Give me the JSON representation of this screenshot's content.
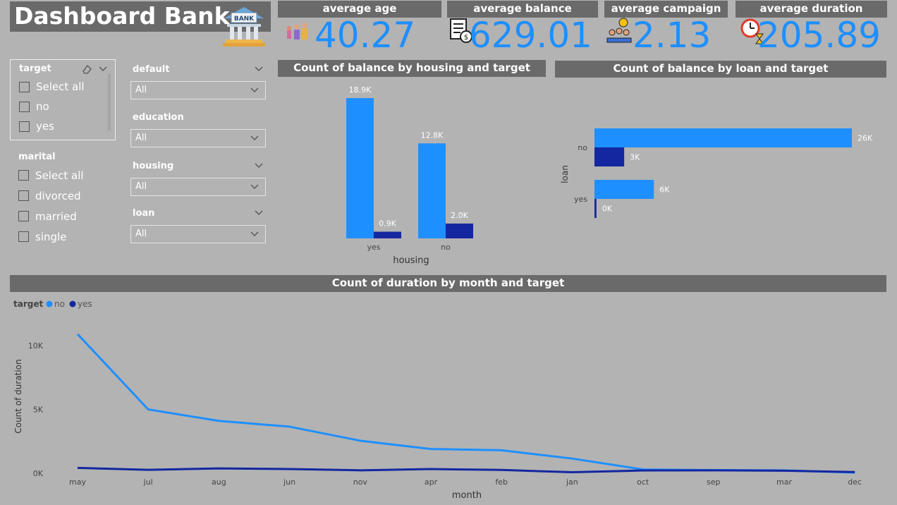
{
  "header": {
    "title": "Dashboard Bank",
    "bank_sign": "BANK"
  },
  "kpis": [
    {
      "label": "average age",
      "value": "40.27",
      "icon": "people-icon"
    },
    {
      "label": "average balance",
      "value": "629.01",
      "icon": "document-money-icon"
    },
    {
      "label": "average campaign",
      "value": "2.13",
      "icon": "meeting-icon"
    },
    {
      "label": "average duration",
      "value": "205.89",
      "icon": "clock-hourglass-icon"
    }
  ],
  "slicers": {
    "target": {
      "title": "target",
      "options": [
        "Select all",
        "no",
        "yes"
      ]
    },
    "marital": {
      "title": "marital",
      "options": [
        "Select all",
        "divorced",
        "married",
        "single"
      ]
    },
    "dropdowns": [
      {
        "label": "default",
        "value": "All"
      },
      {
        "label": "education",
        "value": "All"
      },
      {
        "label": "housing",
        "value": "All"
      },
      {
        "label": "loan",
        "value": "All"
      }
    ]
  },
  "colors": {
    "no": "#1e8fff",
    "yes": "#1427a0",
    "header_bg": "#6a6a6a",
    "page_bg": "#b3b3b3"
  },
  "chart_data": [
    {
      "type": "bar",
      "title": "Count of balance by housing and target",
      "xlabel": "housing",
      "categories": [
        "yes",
        "no"
      ],
      "series": [
        {
          "name": "no",
          "values": [
            18900,
            12800
          ],
          "labels": [
            "18.9K",
            "12.8K"
          ]
        },
        {
          "name": "yes",
          "values": [
            900,
            2000
          ],
          "labels": [
            "0.9K",
            "2.0K"
          ]
        }
      ]
    },
    {
      "type": "bar",
      "orientation": "horizontal",
      "title": "Count of balance by loan and target",
      "ylabel": "loan",
      "categories": [
        "no",
        "yes"
      ],
      "series": [
        {
          "name": "no",
          "values": [
            26000,
            6000
          ],
          "labels": [
            "26K",
            "6K"
          ]
        },
        {
          "name": "yes",
          "values": [
            3000,
            200
          ],
          "labels": [
            "3K",
            "0K"
          ]
        }
      ]
    },
    {
      "type": "line",
      "title": "Count of duration by month and target",
      "xlabel": "month",
      "ylabel": "Count of duration",
      "legend_title": "target",
      "legend_position": "top-left",
      "x": [
        "may",
        "jul",
        "aug",
        "jun",
        "nov",
        "apr",
        "feb",
        "jan",
        "oct",
        "sep",
        "mar",
        "dec"
      ],
      "y_ticks": [
        "0K",
        "5K",
        "10K"
      ],
      "ylim": [
        0,
        11500
      ],
      "series": [
        {
          "name": "no",
          "values": [
            10900,
            5000,
            4100,
            3650,
            2550,
            1900,
            1800,
            1150,
            300,
            250,
            230,
            50
          ]
        },
        {
          "name": "yes",
          "values": [
            420,
            270,
            380,
            330,
            230,
            330,
            260,
            80,
            220,
            230,
            200,
            100
          ]
        }
      ]
    }
  ]
}
